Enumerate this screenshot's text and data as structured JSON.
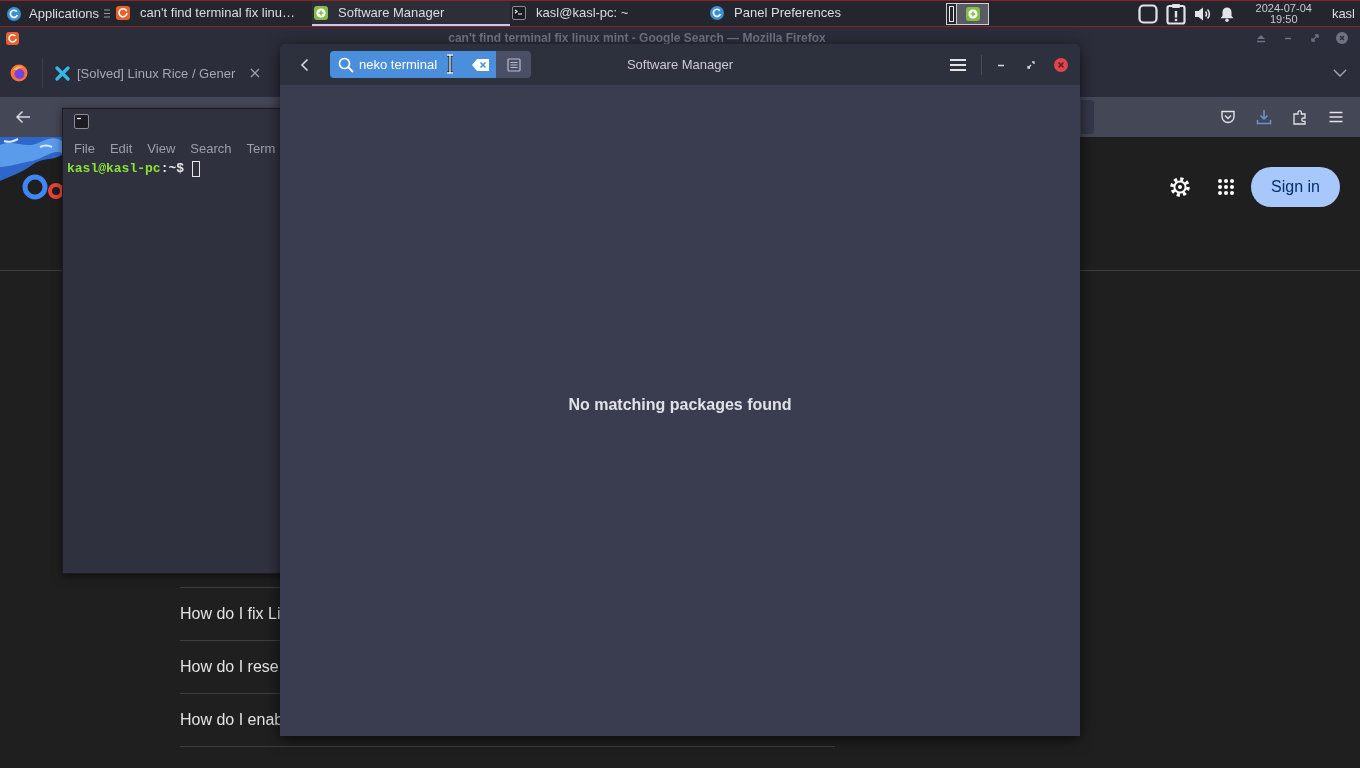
{
  "panel": {
    "menu_label": "Applications",
    "tasks": [
      {
        "kind": "browser",
        "title": "can't find terminal fix linu…",
        "selected": false
      },
      {
        "kind": "software",
        "title": "Software Manager",
        "selected": true
      },
      {
        "kind": "terminal",
        "title": "kasl@kasl-pc: ~",
        "selected": false
      },
      {
        "kind": "preferences",
        "title": "Panel Preferences",
        "selected": false
      }
    ],
    "workspaces": [
      {
        "selected": false
      },
      {
        "selected": true
      }
    ],
    "clock": {
      "date": "2024-07-04",
      "time": "19:50"
    },
    "user": "kasl"
  },
  "browser": {
    "window_title": "can't find terminal fix linux mint - Google Search — Mozilla Firefox",
    "tab_title": "[Solved] Linux Rice / Gener",
    "sign_in": "Sign in",
    "questions": [
      "How do I fix Li",
      "How do I rese",
      "How do I enab"
    ]
  },
  "terminal": {
    "menu": [
      "File",
      "Edit",
      "View",
      "Search",
      "Term"
    ],
    "prompt_user": "kasl@kasl-pc",
    "prompt_path": ":~$"
  },
  "software_manager": {
    "title": "Software Manager",
    "search": {
      "value": "neko terminal"
    },
    "message": "No matching packages found"
  }
}
